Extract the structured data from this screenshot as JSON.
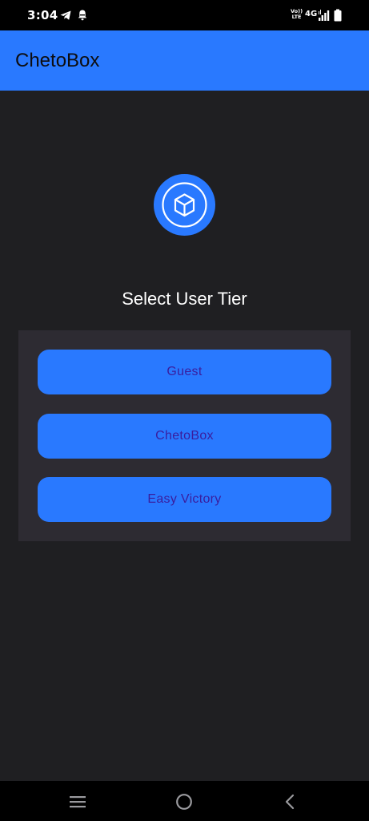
{
  "status_bar": {
    "time": "3:04",
    "network_label": "4G",
    "volte_line1": "Vo))",
    "volte_line2": "LTE",
    "icons": [
      "telegram-icon",
      "notification-bell-icon",
      "signal-icon",
      "battery-icon"
    ]
  },
  "app_bar": {
    "title": "ChetoBox"
  },
  "logo": {
    "icon": "cube-icon",
    "color": "#2979ff"
  },
  "main": {
    "heading": "Select User Tier",
    "tiers": [
      {
        "label": "Guest"
      },
      {
        "label": "ChetoBox"
      },
      {
        "label": "Easy Victory"
      }
    ]
  },
  "nav_bar": {
    "icons": [
      "recent-apps-icon",
      "home-icon",
      "back-icon"
    ]
  },
  "colors": {
    "accent": "#2979ff",
    "background": "#1f1f22",
    "panel": "#2d2b32",
    "button_text": "#3a1e9e"
  }
}
